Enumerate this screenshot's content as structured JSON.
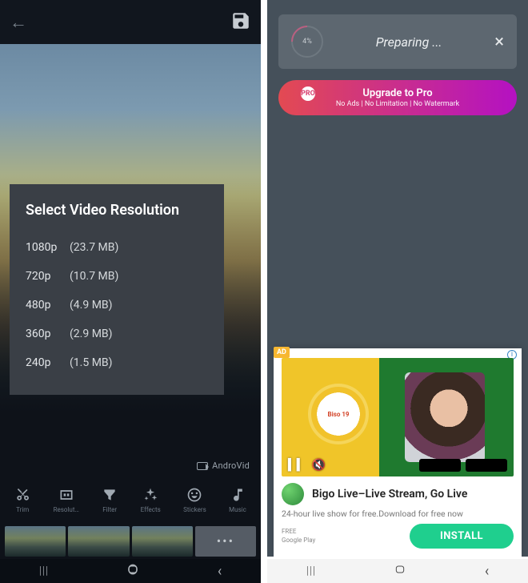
{
  "left": {
    "topbar": {
      "back": "←",
      "save": "save"
    },
    "watermark": "AndroVid",
    "dialog": {
      "title": "Select Video Resolution",
      "options": [
        {
          "res": "1080p",
          "size": "(23.7 MB)"
        },
        {
          "res": "720p",
          "size": "(10.7 MB)"
        },
        {
          "res": "480p",
          "size": "(4.9 MB)"
        },
        {
          "res": "360p",
          "size": "(2.9 MB)"
        },
        {
          "res": "240p",
          "size": "(1.5 MB)"
        }
      ]
    },
    "toolbar": [
      {
        "name": "trim",
        "label": "Trim",
        "icon": "scissors-icon"
      },
      {
        "name": "resolut",
        "label": "Resolut…",
        "icon": "resolution-icon"
      },
      {
        "name": "filter",
        "label": "Filter",
        "icon": "filter-icon"
      },
      {
        "name": "effects",
        "label": "Effects",
        "icon": "effects-icon"
      },
      {
        "name": "stickers",
        "label": "Stickers",
        "icon": "smile-icon"
      },
      {
        "name": "music",
        "label": "Music",
        "icon": "music-icon"
      }
    ],
    "clip_more": "•••"
  },
  "right": {
    "prep": {
      "percent": "4%",
      "label": "Preparing ...",
      "close": "×"
    },
    "upgrade": {
      "title": "Upgrade to Pro",
      "sub": "No Ads | No Limitation | No Watermark",
      "badge": "PRO"
    },
    "ad": {
      "tag": "AD",
      "badge_text": "Biso 19",
      "title": "Bigo Live–Live Stream, Go Live",
      "desc": "24-hour live show for free.Download for free now",
      "meta1": "FREE",
      "meta2": "Google Play",
      "install": "INSTALL"
    }
  },
  "nav": {
    "recent": "|||",
    "home": "home",
    "back": "‹"
  }
}
